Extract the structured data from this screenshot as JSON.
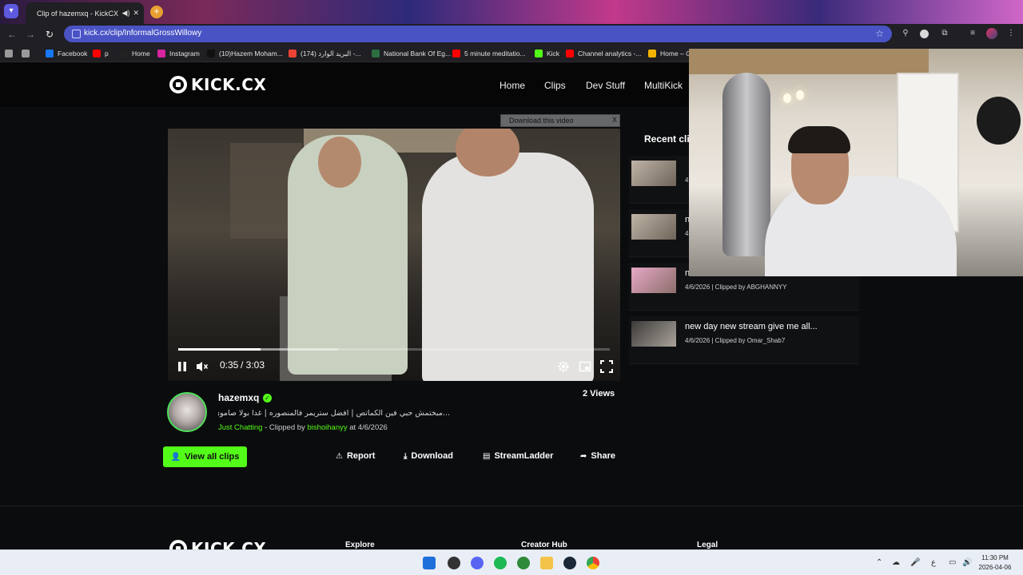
{
  "browser": {
    "tab_title": "Clip of hazemxq - KickCX",
    "tab_mute_icon": "speaker-icon",
    "tab_close": "✕",
    "new_tab": "+",
    "url": "kick.cx/clip/InformalGrossWillowy"
  },
  "bookmarks": [
    {
      "label": "",
      "icon": "square-icon",
      "color": "#9a9a9a"
    },
    {
      "label": "",
      "icon": "apps-grid-icon",
      "color": "#9a9a9a"
    },
    {
      "label": "Facebook",
      "icon": "facebook-icon",
      "color": "#1877f2"
    },
    {
      "label": "p",
      "icon": "youtube-icon",
      "color": "#ff0000"
    },
    {
      "label": "Home",
      "icon": "x-icon",
      "color": "#222222"
    },
    {
      "label": "Instagram",
      "icon": "instagram-icon",
      "color": "#d6249f"
    },
    {
      "label": "(10)Hazem Moham...",
      "icon": "tiktok-icon",
      "color": "#111111"
    },
    {
      "label": "(174) البريد الوارد -...",
      "icon": "gmail-icon",
      "color": "#ea4335"
    },
    {
      "label": "National Bank Of Eg...",
      "icon": "bank-icon",
      "color": "#2b6e3f"
    },
    {
      "label": "5 minute meditatio...",
      "icon": "youtube-icon",
      "color": "#ff0000"
    },
    {
      "label": "Kick",
      "icon": "kick-icon",
      "color": "#53fc18"
    },
    {
      "label": "Channel analytics -...",
      "icon": "youtube-icon",
      "color": "#ff0000"
    },
    {
      "label": "Home – G",
      "icon": "drive-icon",
      "color": "#f4b400"
    }
  ],
  "site": {
    "logo_text": "KICK.CX",
    "nav": [
      "Home",
      "Clips",
      "Dev Stuff",
      "MultiKick"
    ]
  },
  "player": {
    "download_overlay": "Download this video",
    "download_overlay_help": "?",
    "download_overlay_close": "X",
    "current_time": "0:35",
    "duration": "/ 3:03",
    "progress": 0.19,
    "buffered": 0.37
  },
  "clip": {
    "channel": "hazemxq",
    "title": "...مبختمش حبي فين الكماتص | افضل ستريمر فالمنصوره | غدا بولا صاموي",
    "category": "Just Chatting",
    "clipped_by_prefix": "- Clipped by",
    "clipper": "bishoihanyy",
    "date_text": "at 4/6/2026",
    "views": "2 Views"
  },
  "actions": {
    "view_all": "View all clips",
    "report": "Report",
    "download": "Download",
    "streamladder": "StreamLadder",
    "share": "Share"
  },
  "sidebar": {
    "title": "Recent cli",
    "clips": [
      {
        "title": "",
        "meta": "4"
      },
      {
        "title": "n",
        "meta": "4"
      },
      {
        "title": "n",
        "meta": "4/6/2026 | Clipped by ABGHANNYY"
      },
      {
        "title": "new day new stream give me all...",
        "meta": "4/6/2026 | Clipped by Omar_Shab7"
      }
    ]
  },
  "footer": {
    "logo_text": "KICK.CX",
    "columns": [
      "Explore",
      "Creator Hub",
      "Legal"
    ]
  },
  "taskbar": {
    "lang": "ع",
    "time": "11:30 PM",
    "date": "2026-04-06"
  }
}
